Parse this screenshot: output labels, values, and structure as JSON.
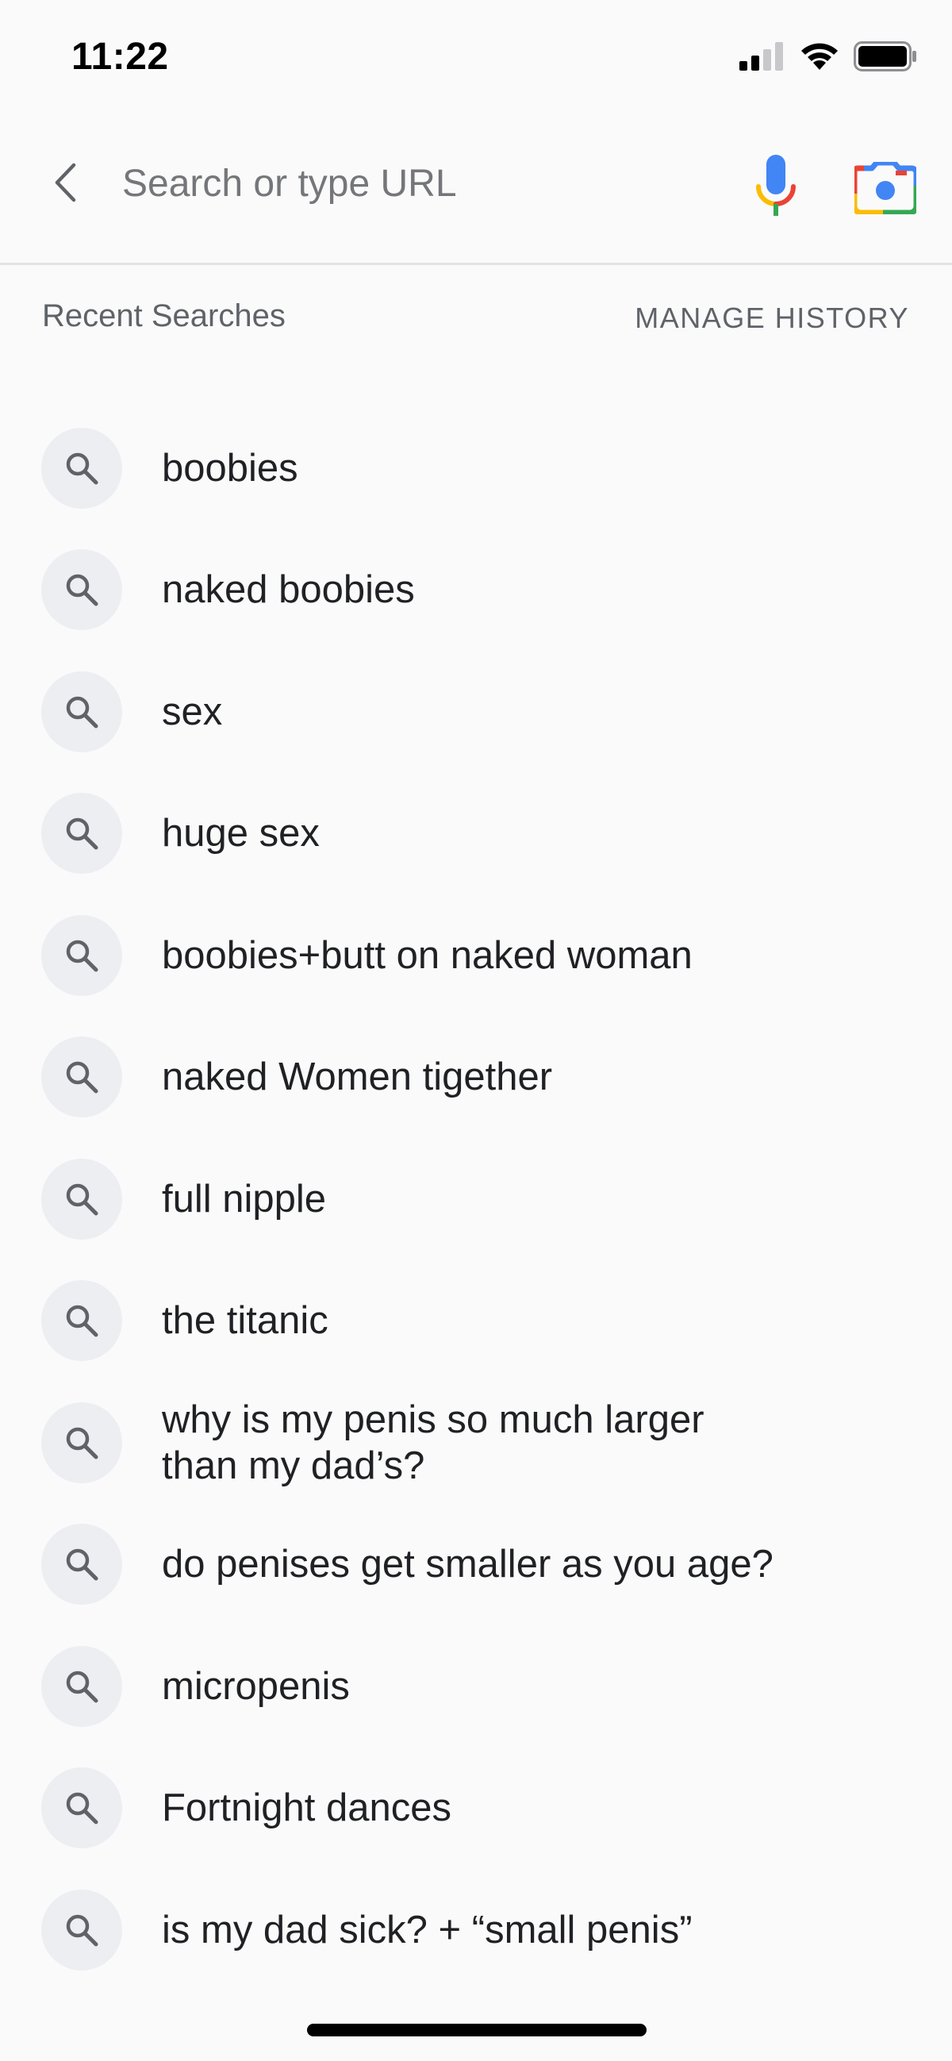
{
  "status_bar": {
    "time": "11:22",
    "icons": [
      "cellular-signal-icon",
      "wifi-icon",
      "battery-icon"
    ]
  },
  "search": {
    "placeholder": "Search or type URL",
    "value": "",
    "back_icon": "chevron-left-icon",
    "mic_icon": "microphone-icon",
    "lens_icon": "camera-lens-icon"
  },
  "history": {
    "title": "Recent Searches",
    "manage_label": "MANAGE HISTORY",
    "item_icon": "search-icon",
    "items": [
      {
        "label": "boobies"
      },
      {
        "label": "naked boobies"
      },
      {
        "label": "sex"
      },
      {
        "label": "huge sex"
      },
      {
        "label": "boobies+butt on naked woman"
      },
      {
        "label": "naked Women tigether"
      },
      {
        "label": "full nipple"
      },
      {
        "label": "the titanic"
      },
      {
        "label": "why is my penis so much larger than my dad’s?"
      },
      {
        "label": "do penises get smaller as you age?"
      },
      {
        "label": "micropenis"
      },
      {
        "label": "Fortnight dances"
      },
      {
        "label": "is my dad sick? + “small penis”"
      }
    ]
  },
  "colors": {
    "background": "#fafafb",
    "text_primary": "#202124",
    "text_secondary": "#5f6368",
    "icon_circle": "#eceef1",
    "google_blue": "#4285f4",
    "google_red": "#ea4335",
    "google_yellow": "#fbbc04",
    "google_green": "#34a853"
  }
}
